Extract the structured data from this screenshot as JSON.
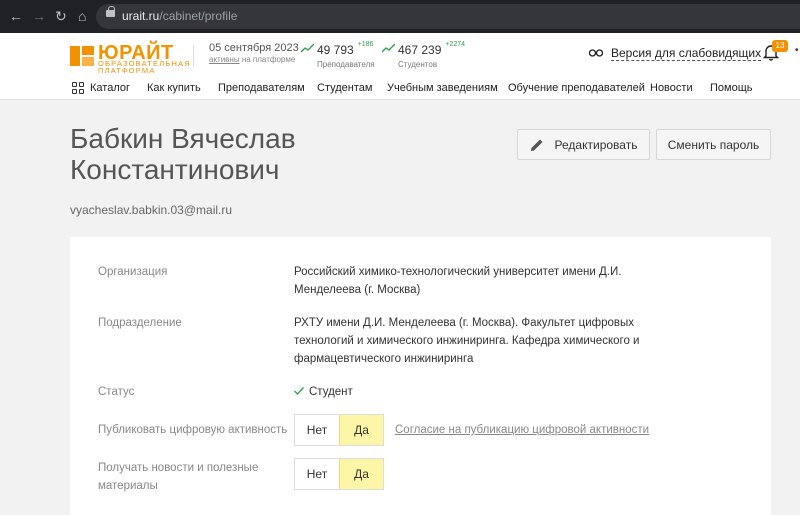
{
  "browser": {
    "url_host": "urait.ru",
    "url_path": "/cabinet/profile"
  },
  "header": {
    "logo_text": "ЮРАЙТ",
    "logo_subtitle": "ОБРАЗОВАТЕЛЬНАЯ ПЛАТФОРМА",
    "date": "05 сентября 2023",
    "date_link": "активны",
    "date_suffix": "на платформе",
    "stats": [
      {
        "value": "49 793",
        "delta": "+186",
        "label": "Преподавателя"
      },
      {
        "value": "467 239",
        "delta": "+2274",
        "label": "Студентов"
      }
    ],
    "accessibility_label": "Версия для слабовидящих",
    "notifications_count": "13",
    "accent_color": "#f39200"
  },
  "menu": {
    "items": [
      "Каталог",
      "Как купить",
      "Преподавателям",
      "Студентам",
      "Учебным заведениям",
      "Обучение преподавателей",
      "Новости",
      "Помощь"
    ]
  },
  "profile": {
    "name": "Бабкин Вячеслав Константинович",
    "email": "vyacheslav.babkin.03@mail.ru",
    "edit_label": "Редактировать",
    "change_password_label": "Сменить пароль"
  },
  "details": {
    "organization_label": "Организация",
    "organization_value": "Российский химико-технологический университет имени Д.И. Менделеева (г. Москва)",
    "division_label": "Подразделение",
    "division_value": "РХТУ имени Д.И. Менделеева (г. Москва). Факультет цифровых технологий и химического инжиниринга. Кафедра химического и фармацевтического инжиниринга",
    "status_label": "Статус",
    "status_value": "Студент",
    "publish_label": "Публиковать цифровую активность",
    "publish_no": "Нет",
    "publish_yes": "Да",
    "publish_selected": "Да",
    "consent_link": "Согласие на публикацию цифровой активности",
    "news_label": "Получать новости и полезные материалы",
    "news_no": "Нет",
    "news_yes": "Да",
    "news_selected": "Да"
  }
}
